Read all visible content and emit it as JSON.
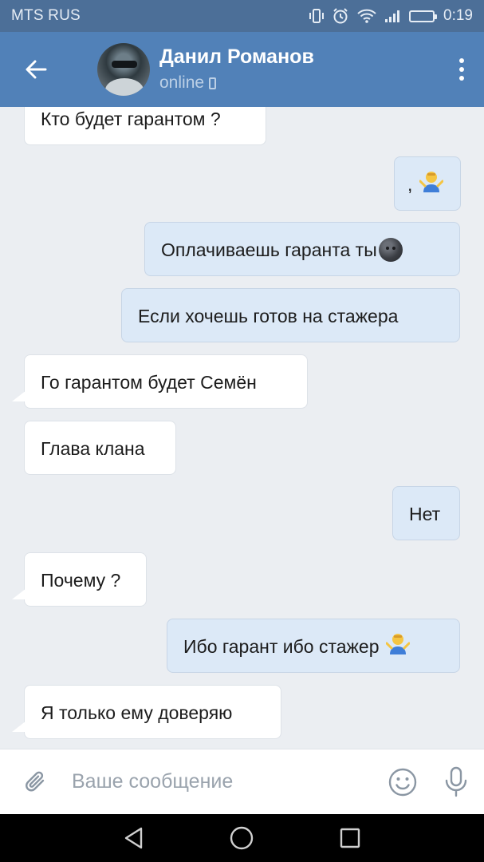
{
  "status_bar": {
    "carrier": "MTS RUS",
    "time": "0:19"
  },
  "header": {
    "contact_name": "Данил Романов",
    "status": "online"
  },
  "messages": [
    {
      "dir": "in",
      "text": "Кто будет гарантом ?"
    },
    {
      "dir": "out",
      "text": ",",
      "emoji": "shrug-emoji"
    },
    {
      "dir": "out",
      "text": "Оплачиваешь гаранта ты",
      "emoji": "new-moon-face-emoji"
    },
    {
      "dir": "out",
      "text": "Если хочешь готов на стажера"
    },
    {
      "dir": "in",
      "text": "Го гарантом будет Семён"
    },
    {
      "dir": "in",
      "text": "Глава клана"
    },
    {
      "dir": "out",
      "text": "Нет"
    },
    {
      "dir": "in",
      "text": "Почему ?"
    },
    {
      "dir": "out",
      "text": "Ибо гарант ибо стажер",
      "emoji": "shrug-emoji"
    },
    {
      "dir": "in",
      "text": "Я только ему доверяю"
    }
  ],
  "composer": {
    "placeholder": "Ваше сообщение"
  },
  "colors": {
    "header": "#5181b8",
    "status_bar": "#4c6f98",
    "chat_bg": "#ebeef2",
    "incoming_bubble": "#ffffff",
    "outgoing_bubble": "#dce9f7"
  },
  "icons": {
    "back": "back-arrow-icon",
    "more": "more-vertical-icon",
    "attach": "paperclip-icon",
    "emoji": "smiley-icon",
    "mic": "microphone-icon",
    "nav_back": "nav-back-icon",
    "nav_home": "nav-home-icon",
    "nav_recent": "nav-recent-icon"
  }
}
